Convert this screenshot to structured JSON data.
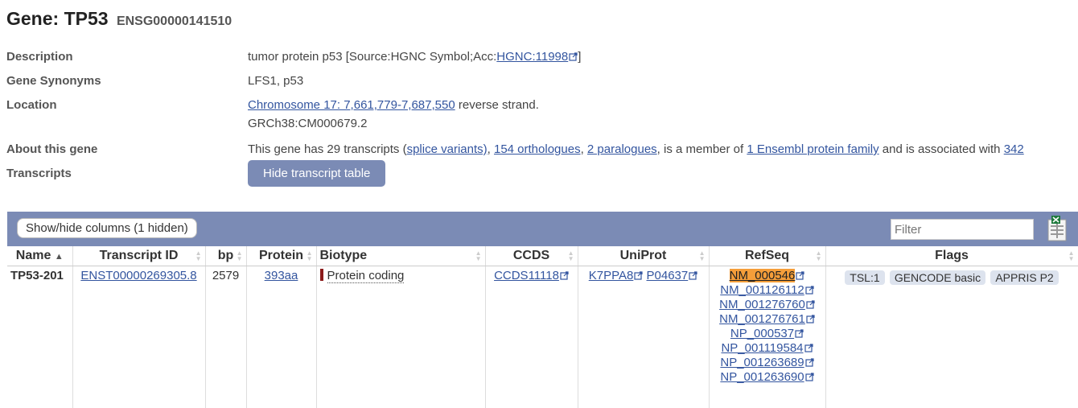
{
  "header": {
    "gene_label": "Gene: TP53",
    "stable_id": "ENSG00000141510"
  },
  "summary": {
    "description_label": "Description",
    "description_text": "tumor protein p53 [Source:HGNC Symbol;Acc:",
    "description_link": "HGNC:11998",
    "description_end": "]",
    "synonyms_label": "Gene Synonyms",
    "synonyms_value": "LFS1, p53",
    "location_label": "Location",
    "location_link": "Chromosome 17: 7,661,779-7,687,550",
    "location_strand": " reverse strand.",
    "location_assembly": "GRCh38:CM000679.2",
    "about_label": "About this gene",
    "about_t1": "This gene has 29 transcripts (",
    "about_l1": "splice variants)",
    "about_t2": ", ",
    "about_l2": "154 orthologues",
    "about_t3": ", ",
    "about_l3": "2 paralogues",
    "about_t4": ", is a member of ",
    "about_l4": "1 Ensembl protein family",
    "about_t5": " and is associated with ",
    "about_l5": "342",
    "transcripts_label": "Transcripts",
    "hide_button": "Hide transcript table"
  },
  "table_bar": {
    "showhide_label": "Show/hide columns (1 hidden)",
    "filter_placeholder": "Filter"
  },
  "columns": [
    "Name",
    "Transcript ID",
    "bp",
    "Protein",
    "Biotype",
    "CCDS",
    "UniProt",
    "RefSeq",
    "Flags"
  ],
  "name_sort_arrow": "▲",
  "row": {
    "name": "TP53-201",
    "transcript_id": "ENST00000269305.8",
    "bp": "2579",
    "protein": "393aa",
    "biotype": "Protein coding",
    "ccds": "CCDS11118",
    "uniprot_1": "K7PPA8",
    "uniprot_2": "P04637",
    "refseq": [
      "NM_000546",
      "NM_001126112",
      "NM_001276760",
      "NM_001276761",
      "NP_000537",
      "NP_001119584",
      "NP_001263689",
      "NP_001263690"
    ],
    "flags": [
      "TSL:1",
      "GENCODE basic",
      "APPRIS P2"
    ]
  },
  "colors": {
    "bar": "#7b8bb5",
    "link": "#33559f",
    "highlight": "#f59e3a",
    "biotype": "#8b1a1a"
  }
}
